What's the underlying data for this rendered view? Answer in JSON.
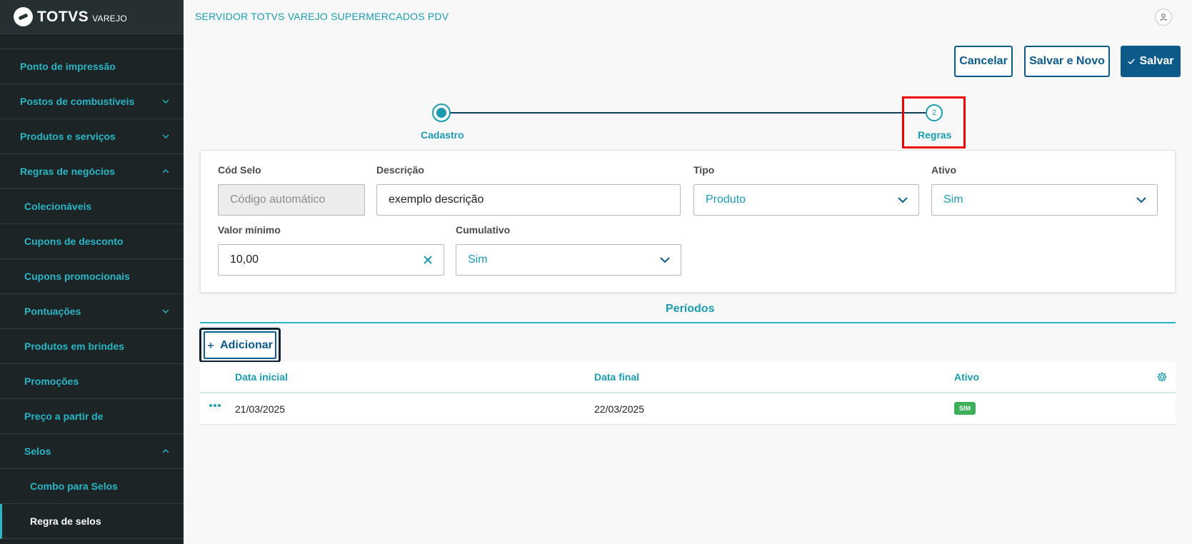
{
  "brand": {
    "name": "TOTVS",
    "sub": "VAREJO"
  },
  "header": {
    "title": "SERVIDOR TOTVS VAREJO SUPERMERCADOS PDV"
  },
  "sidebar": {
    "items": [
      {
        "label": "Ponto de impressão"
      },
      {
        "label": "Postos de combustíveis"
      },
      {
        "label": "Produtos e serviços"
      },
      {
        "label": "Regras de negócios"
      },
      {
        "label": "Colecionáveis"
      },
      {
        "label": "Cupons de desconto"
      },
      {
        "label": "Cupons promocionais"
      },
      {
        "label": "Pontuações"
      },
      {
        "label": "Produtos em brindes"
      },
      {
        "label": "Promoções"
      },
      {
        "label": "Preço a partir de"
      },
      {
        "label": "Selos"
      },
      {
        "label": "Combo para Selos"
      },
      {
        "label": "Regra de selos"
      }
    ]
  },
  "actions": {
    "cancel": "Cancelar",
    "save_new": "Salvar e Novo",
    "save": "Salvar"
  },
  "stepper": {
    "step1_label": "Cadastro",
    "step2_number": "2",
    "step2_label": "Regras"
  },
  "form": {
    "cod_selo": {
      "label": "Cód Selo",
      "placeholder": "Código automático"
    },
    "descricao": {
      "label": "Descrição",
      "value": "exemplo descrição"
    },
    "tipo": {
      "label": "Tipo",
      "value": "Produto"
    },
    "ativo": {
      "label": "Ativo",
      "value": "Sim"
    },
    "valor_minimo": {
      "label": "Valor mínimo",
      "value": "10,00"
    },
    "cumulativo": {
      "label": "Cumulativo",
      "value": "Sim"
    }
  },
  "periods": {
    "tab_label": "Períodos",
    "add_label": "Adicionar",
    "columns": [
      "Data inicial",
      "Data final",
      "Ativo"
    ],
    "rows": [
      {
        "data_inicial": "21/03/2025",
        "data_final": "22/03/2025",
        "ativo": "SIM"
      }
    ]
  },
  "colors": {
    "primary": "#0c5a8a",
    "accent": "#1c9bb0",
    "sidebar_bg": "#1d2426",
    "success": "#3fae5a",
    "highlight": "#ee0000"
  }
}
